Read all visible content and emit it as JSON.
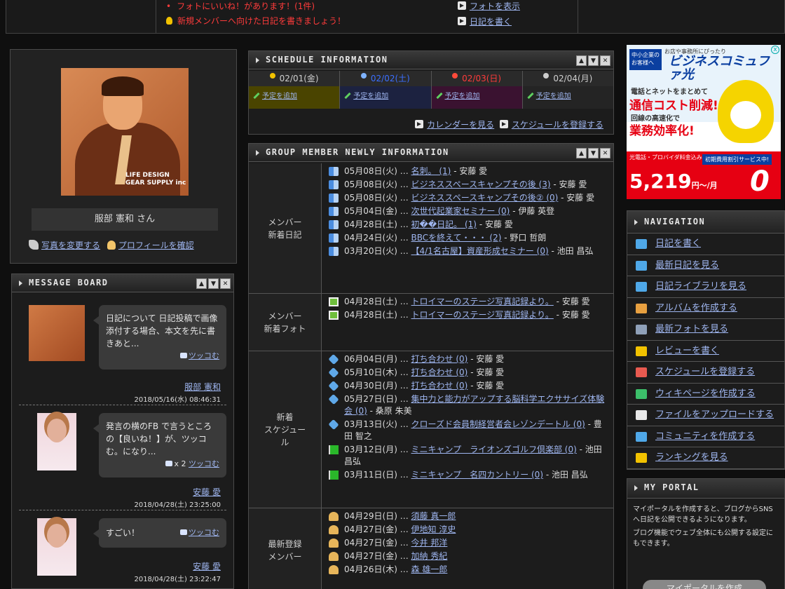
{
  "topbar": {
    "notice1": "フォトにいいね！があります！(1件)",
    "notice2": "新規メンバーへ向けた日記を書きましょう！",
    "link1": "フォトを表示",
    "link2": "日記を書く"
  },
  "profile": {
    "brand": "LIFE DESIGN GEAR SUPPLY inc",
    "name": "服部 憲和 さん",
    "change_photo": "写真を変更する",
    "check_profile": "プロフィールを確認"
  },
  "message_board": {
    "title": "MESSAGE BOARD",
    "messages": [
      {
        "text": "日記について 日記投稿で画像添付する場合、本文を先に書きあと...",
        "reply": "ツッコむ",
        "author": "服部 憲和",
        "date": "2018/05/16(水) 08:46:31"
      },
      {
        "text": "発言の横のFB で言うところの【良いね！】が、ツッコむ。になり...",
        "count": "x 2",
        "reply": "ツッコむ",
        "author": "安藤 愛",
        "date": "2018/04/28(土) 23:25:00"
      },
      {
        "text": "すごい！",
        "reply": "ツッコむ",
        "author": "安藤 愛",
        "date": "2018/04/28(土) 23:22:47"
      }
    ]
  },
  "schedule": {
    "title": "SCHEDULE INFORMATION",
    "days": [
      "02/01(金)",
      "02/02(土)",
      "02/03(日)",
      "02/04(月)"
    ],
    "add_label": "予定を追加",
    "calendar_link": "カレンダーを見る",
    "register_link": "スケジュールを登録する"
  },
  "group": {
    "title": "GROUP MEMBER NEWLY INFORMATION",
    "sections": [
      {
        "category": "メンバー\n新着日記",
        "items": [
          {
            "date": "05月08日(火) …",
            "title": "名刺。 (1)",
            "by": "- 安藤 愛"
          },
          {
            "date": "05月08日(火) …",
            "title": "ビジネススペースキャンプその後 (3)",
            "by": "- 安藤 愛"
          },
          {
            "date": "05月08日(火) …",
            "title": "ビジネススペースキャンプその後② (0)",
            "by": "- 安藤 愛"
          },
          {
            "date": "05月04日(金) …",
            "title": "次世代起業家セミナー (0)",
            "by": "- 伊藤 英登"
          },
          {
            "date": "04月28日(土) …",
            "title": "初��日記。 (1)",
            "by": "- 安藤 愛"
          },
          {
            "date": "04月24日(火) …",
            "title": "BBCを終えて・・・ (2)",
            "by": "- 野口 哲朗"
          },
          {
            "date": "03月20日(火) …",
            "title": "【4/1名古屋】資産形成セミナー (0)",
            "by": "- 池田 昌弘"
          }
        ]
      },
      {
        "category": "メンバー\n新着フォト",
        "items": [
          {
            "date": "04月28日(土) …",
            "title": "トロイマーのステージ写真記録より。",
            "by": "- 安藤 愛"
          },
          {
            "date": "04月28日(土) …",
            "title": "トロイマーのステージ写真記録より。",
            "by": "- 安藤 愛"
          }
        ]
      },
      {
        "category": "新着\nスケジュー\nル",
        "items": [
          {
            "date": "06月04日(月) …",
            "title": "打ち合わせ (0)",
            "by": "- 安藤 愛"
          },
          {
            "date": "05月10日(木) …",
            "title": "打ち合わせ (0)",
            "by": "- 安藤 愛"
          },
          {
            "date": "04月30日(月) …",
            "title": "打ち合わせ (0)",
            "by": "- 安藤 愛"
          },
          {
            "date": "05月27日(日) …",
            "title": "集中力と能力がアップする脳科学エクササイズ体験会 (0)",
            "by": "- 桑原 朱美"
          },
          {
            "date": "03月13日(火) …",
            "title": "クローズド会員制経営者会レゾンデートル (0)",
            "by": "- 豊田 智之"
          },
          {
            "date": "03月12日(月) …",
            "title": "ミニキャンプ　ライオンズゴルフ倶楽部 (0)",
            "by": "- 池田 昌弘"
          },
          {
            "date": "03月11日(日) …",
            "title": "ミニキャンプ　名四カントリー (0)",
            "by": "- 池田 昌弘"
          }
        ]
      },
      {
        "category": "最新登録\nメンバー",
        "items": [
          {
            "date": "04月29日(日) …",
            "title": "須藤 真一郎",
            "by": ""
          },
          {
            "date": "04月27日(金) …",
            "title": "伊地知 淳史",
            "by": ""
          },
          {
            "date": "04月27日(金) …",
            "title": "今井 邦洋",
            "by": ""
          },
          {
            "date": "04月27日(金) …",
            "title": "加納 秀紀",
            "by": ""
          },
          {
            "date": "04月26日(木) …",
            "title": "森 雄一郎",
            "by": ""
          }
        ]
      }
    ]
  },
  "ad": {
    "badge": "中小企業のお客様へ",
    "small": "お店や事務所にぴったり",
    "title": "ビジネスコミュファ光",
    "line1": "電話とネットをまとめて",
    "line2": "通信コスト削減!",
    "line3": "回線の高速化で",
    "line4": "業務効率化!",
    "note": "光電話・プロバイダ料金込み 光インターネットが",
    "price": "5,219",
    "price_unit": "円～/月",
    "promo": "初期費用割引サービス中!",
    "zero": "0"
  },
  "navigation": {
    "title": "NAVIGATION",
    "items": [
      "日記を書く",
      "最新日記を見る",
      "日記ライブラリを見る",
      "アルバムを作成する",
      "最新フォトを見る",
      "レビューを書く",
      "スケジュールを登録する",
      "ウィキページを作成する",
      "ファイルをアップロードする",
      "コミュニティを作成する",
      "ランキングを見る"
    ]
  },
  "portal": {
    "title": "MY PORTAL",
    "text1": "マイポータルを作成すると、ブログからSNSへ日記を公開できるようになります。",
    "text2": "ブログ機能でウェブ全体にも公開する設定にもできます。",
    "button": "マイポータルを作成"
  }
}
